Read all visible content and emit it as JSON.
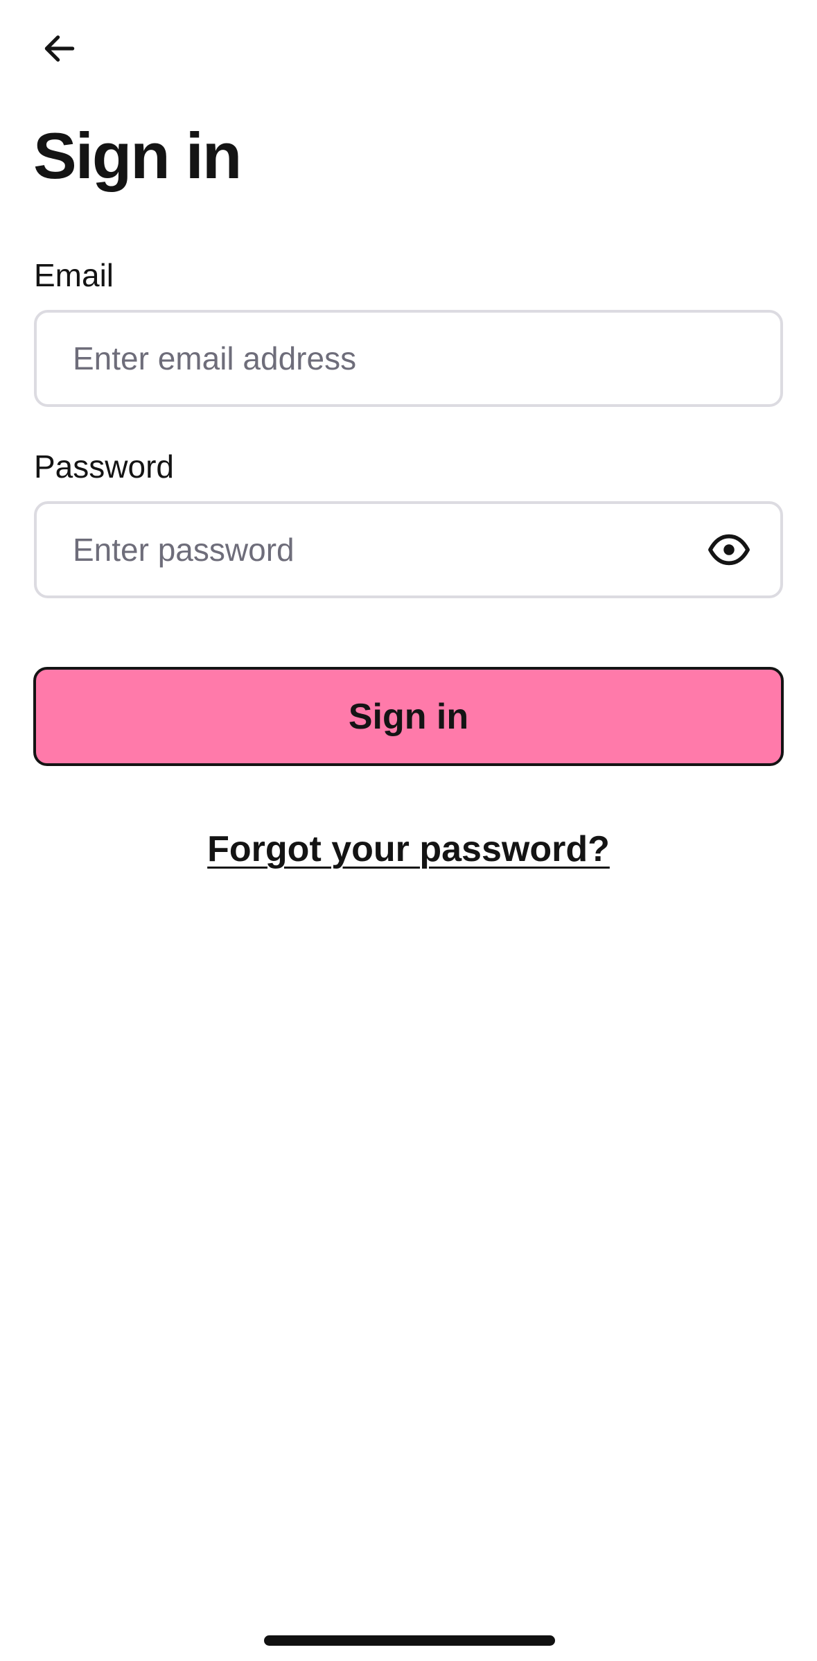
{
  "header": {
    "back_icon": "arrow-left-icon"
  },
  "page": {
    "title": "Sign in"
  },
  "form": {
    "email": {
      "label": "Email",
      "value": "",
      "placeholder": "Enter email address"
    },
    "password": {
      "label": "Password",
      "value": "",
      "placeholder": "Enter password",
      "toggle_icon": "eye-icon"
    },
    "submit_label": "Sign in",
    "forgot_label": "Forgot your password?"
  },
  "colors": {
    "primary_button": "#ff7aaa",
    "text": "#141414",
    "placeholder": "#6e6d7a",
    "input_border": "#dcdbe1"
  }
}
